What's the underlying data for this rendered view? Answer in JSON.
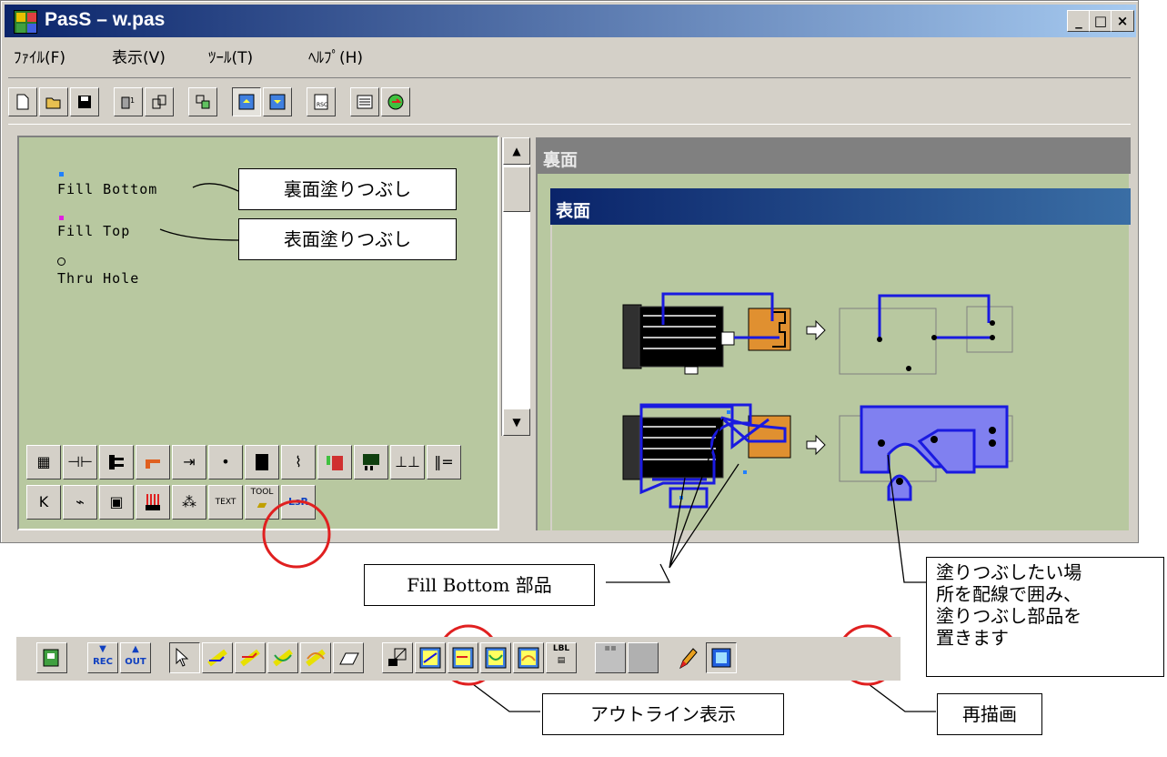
{
  "window": {
    "title": "PasS – w.pas",
    "controls": {
      "minimize": "_",
      "maximize": "□",
      "close": "×"
    }
  },
  "menu": [
    "ﾌｧｲﾙ(F)",
    "表示(V)",
    "ﾂｰﾙ(T)",
    "ﾍﾙﾌﾟ(H)"
  ],
  "toolbar": {
    "buttons": [
      "new-file-icon",
      "open-folder-icon",
      "save-disk-icon",
      "part-edit-icon",
      "library-icon",
      "outline-pattern-icon",
      "view-top-icon",
      "view-bottom-icon",
      "rsc-icon",
      "netlist-icon",
      "refresh-green-icon"
    ],
    "pressed_index": 6
  },
  "left_panel": {
    "labels": [
      "Fill Bottom",
      "Fill Top",
      "Thru Hole"
    ],
    "marker_colors": {
      "fill_bottom": "#2080ff",
      "fill_top": "#e020e0"
    }
  },
  "callouts": {
    "fill_bottom_label": "裏面塗りつぶし",
    "fill_top_label": "表面塗りつぶし",
    "part_label": "Fill Bottom 部品",
    "instruction": [
      "塗りつぶしたい場",
      "所を配線で囲み、",
      "塗りつぶし部品を",
      "置きます"
    ],
    "outline_label": "アウトライン表示",
    "redraw_label": "再描画"
  },
  "palette": {
    "row1": [
      "grid",
      "capacitor",
      "connector",
      "jumper",
      "diode",
      "dot",
      "ic",
      "switch",
      "led",
      "transistor",
      "cap-flat",
      "hdr"
    ],
    "row2": [
      "K",
      "resistor",
      "ic2",
      "comb",
      "tri",
      "TEXT",
      "TOOL",
      "LSR"
    ]
  },
  "right_panel": {
    "back_title": "裏面",
    "front_title": "表面"
  },
  "colors": {
    "pcb_bg": "#b8c8a0",
    "trace_blue": "#1a1ae0",
    "fill_blue": "#8080f0",
    "part_orange": "#e09030",
    "highlight_red": "#e02020"
  },
  "bottom_toolbar": {
    "rec_label": "REC",
    "out_label": "OUT",
    "lbl_label": "LBL"
  }
}
